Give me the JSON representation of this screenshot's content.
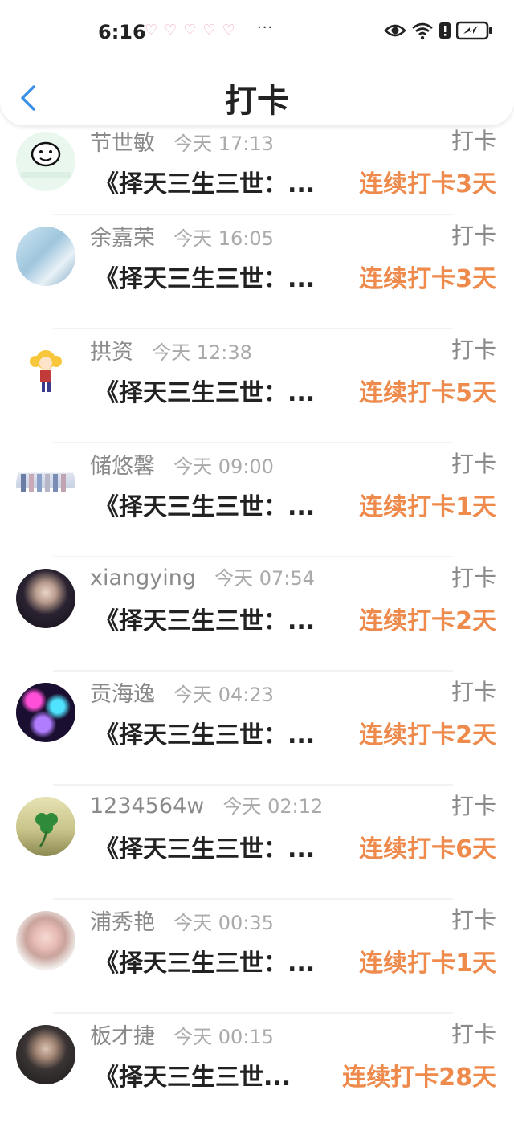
{
  "status": {
    "time": "6:16",
    "dots": "···"
  },
  "header": {
    "title": "打卡"
  },
  "colors": {
    "accent": "#ee8a4b",
    "back": "#3a8fe6",
    "muted": "#8a8a8a"
  },
  "icons": {
    "back": "chevron-left-icon",
    "status": [
      "eye-icon",
      "wifi-icon",
      "alert-icon",
      "battery-charging-icon"
    ]
  },
  "list": {
    "items": [
      {
        "name": "节世敏",
        "time": "今天 17:13",
        "action": "打卡",
        "book": "《择天三生三世：...",
        "streak": "连续打卡3天",
        "avatar": "cartoon-avatar"
      },
      {
        "name": "余嘉荣",
        "time": "今天 16:05",
        "action": "打卡",
        "book": "《择天三生三世：...",
        "streak": "连续打卡3天",
        "avatar": "room-scene-avatar"
      },
      {
        "name": "拱资",
        "time": "今天 12:38",
        "action": "打卡",
        "book": "《择天三生三世：...",
        "streak": "连续打卡5天",
        "avatar": "anime-girl-avatar"
      },
      {
        "name": "储悠馨",
        "time": "今天 09:00",
        "action": "打卡",
        "book": "《择天三生三世：...",
        "streak": "连续打卡1天",
        "avatar": "group-photo-avatar"
      },
      {
        "name": "xiangying",
        "time": "今天 07:54",
        "action": "打卡",
        "book": "《择天三生三世：...",
        "streak": "连续打卡2天",
        "avatar": "portrait-avatar"
      },
      {
        "name": "贡海逸",
        "time": "今天 04:23",
        "action": "打卡",
        "book": "《择天三生三世：...",
        "streak": "连续打卡2天",
        "avatar": "bokeh-avatar"
      },
      {
        "name": "1234564w",
        "time": "今天 02:12",
        "action": "打卡",
        "book": "《择天三生三世：...",
        "streak": "连续打卡6天",
        "avatar": "clover-avatar"
      },
      {
        "name": "浦秀艳",
        "time": "今天 00:35",
        "action": "打卡",
        "book": "《择天三生三世：...",
        "streak": "连续打卡1天",
        "avatar": "girl-portrait-avatar"
      },
      {
        "name": "板才捷",
        "time": "今天 00:15",
        "action": "打卡",
        "book": "《择天三生三世...",
        "streak": "连续打卡28天",
        "avatar": "boy-portrait-avatar"
      }
    ]
  }
}
